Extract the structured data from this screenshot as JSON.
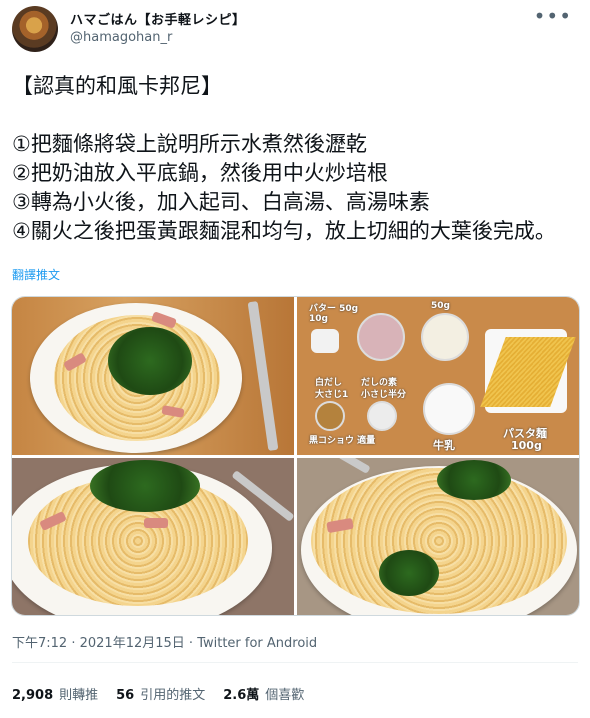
{
  "author": {
    "display_name": "ハマごはん【お手軽レシピ】",
    "handle": "@hamagohan_r"
  },
  "more_icon": "more-horizontal-icon",
  "tweet": {
    "text": "【認真的和風卡邦尼】\n\n①把麵條將袋上說明所示水煮然後瀝乾\n②把奶油放入平底鍋，然後用中火炒培根\n③轉為小火後，加入起司、白高湯、高湯味素\n④關火之後把蛋黃跟麵混和均勻，放上切細的大葉後完成。",
    "translate_label": "翻譯推文"
  },
  "media": {
    "ingredient_labels": {
      "butter": "バター",
      "butter_amount": "10g",
      "bacon_amount": "50g",
      "cheese_amount": "50g",
      "shiro_dashi": "白だし",
      "shiro_dashi_amount": "大さじ1",
      "dashi_moto": "だしの素",
      "dashi_moto_amount": "小さじ半分",
      "pepper": "黒コショウ",
      "pepper_amount": "適量",
      "milk": "牛乳",
      "pasta": "パスタ麺",
      "pasta_amount": "100g"
    }
  },
  "meta": {
    "time": "下午7:12",
    "date": "2021年12月15日",
    "source": "Twitter for Android"
  },
  "stats": [
    {
      "value": "2,908",
      "label": "則轉推"
    },
    {
      "value": "56",
      "label": "引用的推文"
    },
    {
      "value": "2.6萬",
      "label": "個喜歡"
    }
  ]
}
